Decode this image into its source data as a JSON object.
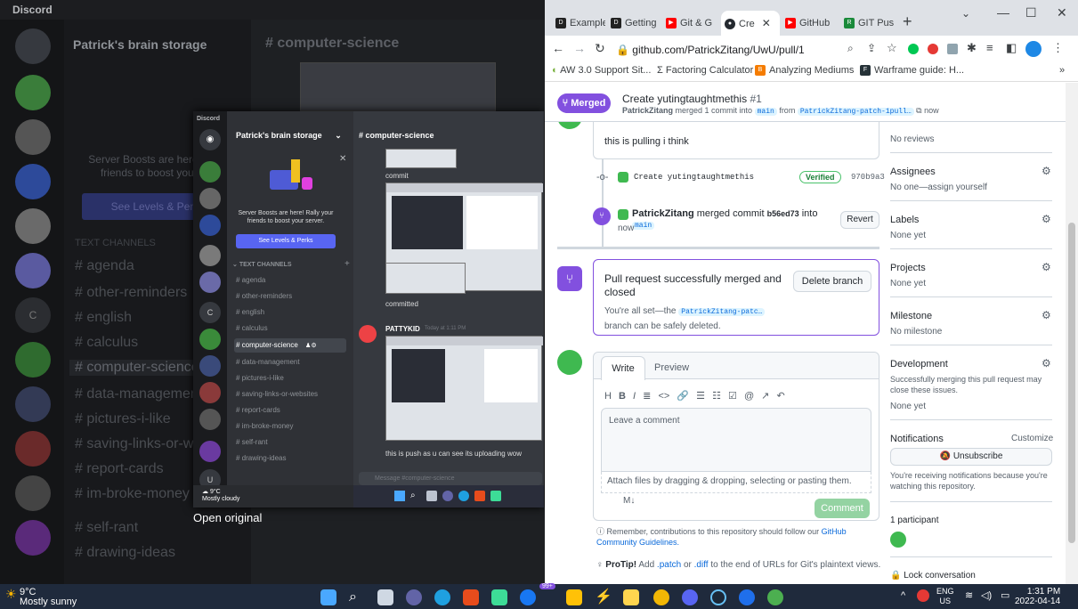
{
  "discord": {
    "app_title": "Discord",
    "server_name": "Patrick's brain storage",
    "channel_header": "computer-science",
    "boost_text": "Server Boosts are here! Rally your friends to boost your server.",
    "boost_text_bg": "Server Boosts are here! Ra friends to boost your s",
    "boost_button": "See Levels & Perks",
    "boost_button_bg": "See Levels & Perks",
    "text_channels_label": "TEXT CHANNELS",
    "channels": [
      "agenda",
      "other-reminders",
      "english",
      "calculus",
      "computer-science",
      "data-management",
      "pictures-i-like",
      "saving-links-or-websites",
      "report-cards",
      "im-broke-money",
      "self-rant",
      "drawing-ideas"
    ],
    "channels_bg": [
      "agenda",
      "other-reminders",
      "english",
      "calculus",
      "computer-science",
      "data-management",
      "pictures-i-like",
      "saving-links-or-web",
      "report-cards",
      "im-broke-money",
      "self-rant",
      "drawing-ideas"
    ],
    "selected_channel": "computer-science",
    "msg_commit": "commit",
    "msg_committed": "committed",
    "msg_author": "PATTYKID",
    "msg_time": "Today at 1:11 PM",
    "msg_push": "this is push as u can see its uploading wow",
    "message_placeholder": "Message #computer-science",
    "user_initial": "U",
    "mini_weather_temp": "9°C",
    "mini_weather_desc": "Mostly cloudy",
    "open_original": "Open original",
    "rail_letter": "C"
  },
  "chrome": {
    "tabs": [
      {
        "label": "Example",
        "icon": "d2l-icon",
        "color": "#222222"
      },
      {
        "label": "Getting",
        "icon": "d2l-icon",
        "color": "#222222"
      },
      {
        "label": "Git & G",
        "icon": "youtube-icon",
        "color": "#ff0000"
      },
      {
        "label": "Cre",
        "icon": "github-icon",
        "color": "#24292f"
      },
      {
        "label": "GitHub",
        "icon": "youtube-icon",
        "color": "#ff0000"
      },
      {
        "label": "GIT Pus",
        "icon": "page-icon",
        "color": "#1a8a3a"
      }
    ],
    "url": "github.com/PatrickZitang/UwU/pull/1",
    "bookmarks": [
      "AW 3.0 Support Sit...",
      "Factoring Calculator",
      "Analyzing Mediums",
      "Warframe guide: H..."
    ],
    "bookmark_more": "»"
  },
  "pr": {
    "status": "Merged",
    "title": "Create yutingtaughtmethis",
    "number": "#1",
    "author": "PatrickZitang",
    "merge_text": "merged 1 commit into",
    "base_branch": "main",
    "from_text": "from",
    "head_branch": "PatrickZitang-patch-1pull…",
    "time": "now",
    "comment_body": "this is pulling i think",
    "commit_message": "Create yutingtaughtmethis",
    "verified": "Verified",
    "commit_sha": "970b9a3",
    "merged_event_author": "PatrickZitang",
    "merged_event_text": "merged commit",
    "merged_event_sha": "b56ed73",
    "merged_event_into": "into",
    "merged_event_branch": "main",
    "merged_event_time": "now",
    "revert": "Revert",
    "success_title": "Pull request successfully merged and closed",
    "success_desc_1": "You're all set—the",
    "success_branch": "PatrickZitang-patc…",
    "success_desc_2": "branch can be safely deleted.",
    "delete_branch": "Delete branch",
    "write_tab": "Write",
    "preview_tab": "Preview",
    "toolbar": [
      "H",
      "B",
      "I",
      "≣",
      "<>",
      "🔗",
      "☰",
      "☷",
      "☑",
      "@",
      "↗",
      "↶"
    ],
    "comment_placeholder": "Leave a comment",
    "attach_text": "Attach files by dragging & dropping, selecting or pasting them.",
    "comment_button": "Comment",
    "remember_text": "Remember, contributions to this repository should follow our",
    "guidelines_link": "GitHub Community Guidelines.",
    "protip_label": "ProTip!",
    "protip_text_1": "Add",
    "protip_patch": ".patch",
    "protip_or": "or",
    "protip_diff": ".diff",
    "protip_text_2": "to the end of URLs for Git's plaintext views.",
    "lock_text": "Lock conversation"
  },
  "sidebar": {
    "reviewers_title": "Reviewers",
    "reviewers_val": "No reviews",
    "assignees_title": "Assignees",
    "assignees_val": "No one—assign yourself",
    "labels_title": "Labels",
    "labels_val": "None yet",
    "projects_title": "Projects",
    "projects_val": "None yet",
    "milestone_title": "Milestone",
    "milestone_val": "No milestone",
    "development_title": "Development",
    "development_desc": "Successfully merging this pull request may close these issues.",
    "development_val": "None yet",
    "notifications_title": "Notifications",
    "customize": "Customize",
    "unsubscribe": "Unsubscribe",
    "notif_desc": "You're receiving notifications because you're watching this repository.",
    "participants": "1 participant"
  },
  "taskbar": {
    "weather_temp": "9°C",
    "weather_desc": "Mostly sunny",
    "lang": "ENG",
    "region": "US",
    "time": "1:31 PM",
    "date": "2022-04-14",
    "badge": "99+"
  },
  "colors": {
    "merged_purple": "#8250df",
    "discord_blurple": "#5865f2",
    "comment_green": "#94d3a2"
  }
}
